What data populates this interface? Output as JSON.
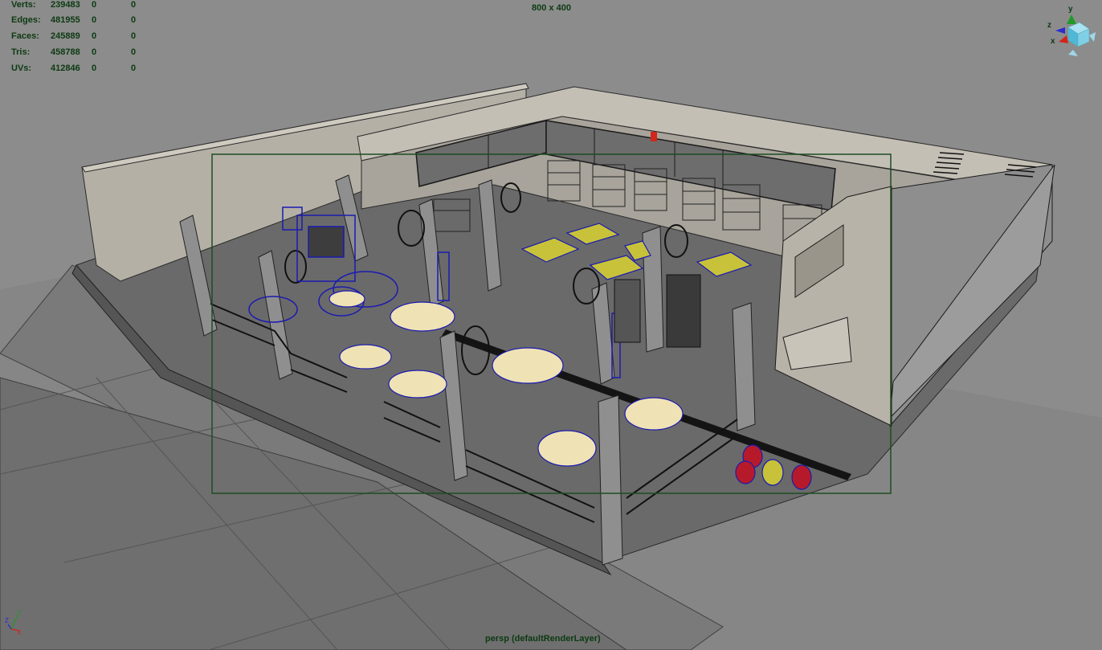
{
  "hud": {
    "stats": [
      {
        "label": "Verts:",
        "values": [
          "239483",
          "0",
          "0"
        ]
      },
      {
        "label": "Edges:",
        "values": [
          "481955",
          "0",
          "0"
        ]
      },
      {
        "label": "Faces:",
        "values": [
          "245889",
          "0",
          "0"
        ]
      },
      {
        "label": "Tris:",
        "values": [
          "458788",
          "0",
          "0"
        ]
      },
      {
        "label": "UVs:",
        "values": [
          "412846",
          "0",
          "0"
        ]
      }
    ],
    "resolution": "800 x 400",
    "camera": "persp (defaultRenderLayer)"
  },
  "view_cube": {
    "axis_y": "y",
    "axis_z": "z",
    "axis_x": "x"
  },
  "axis_indicator": {
    "y": "Y",
    "z": "Z",
    "x": "X"
  },
  "colors": {
    "background": "#8c8c8c",
    "hud_text": "#0c3a12",
    "resolution_gate": "#1d4d22",
    "wireframe_selected": "#1b1bb0",
    "table_top": "#efe2b5",
    "table_panel": "#c8c23a"
  }
}
